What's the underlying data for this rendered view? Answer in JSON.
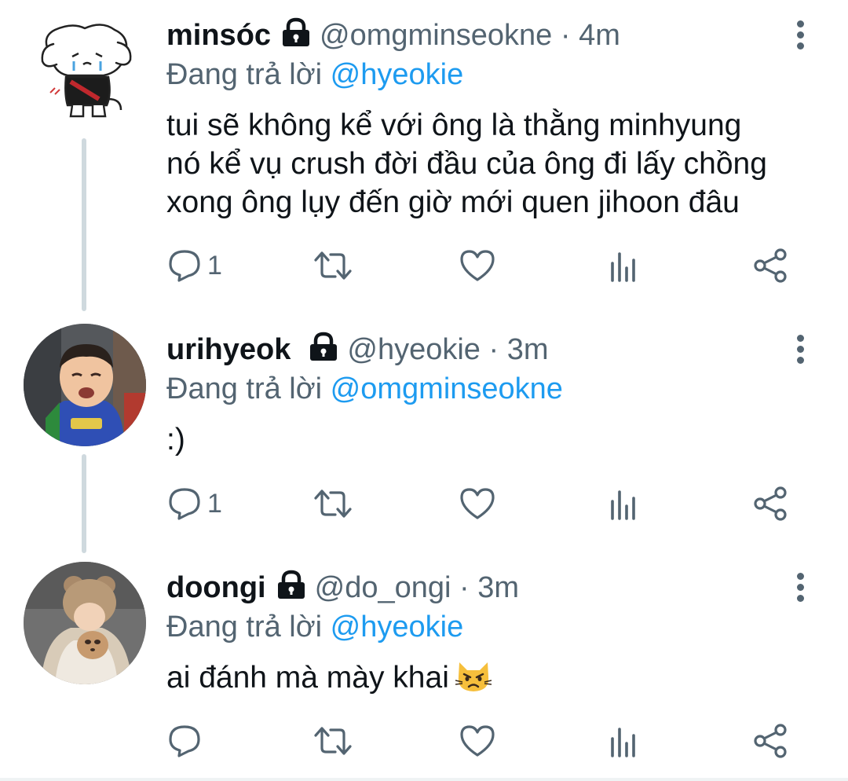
{
  "tweets": [
    {
      "display_name": "minsóc",
      "handle": "@omgminseokne",
      "dot": "·",
      "time": "4m",
      "replying_prefix": "Đang trả lời",
      "replying_to": "@hyeokie",
      "text_lines": [
        "tui sẽ không kể với ông là thằng minhyung",
        "nó kể vụ crush đời đầu của ông đi lấy chồng",
        "xong ông lụy đến giờ mới quen jihoon đâu"
      ],
      "reply_count": "1",
      "avatar": "doodle-puppy-avatar"
    },
    {
      "display_name": "urihyeok",
      "handle": "@hyeokie",
      "dot": "·",
      "time": "3m",
      "replying_prefix": "Đang trả lời",
      "replying_to": "@omgminseokne",
      "text_lines": [
        ":)"
      ],
      "reply_count": "1",
      "avatar": "crying-baby-photo-avatar"
    },
    {
      "display_name": "doongi",
      "handle": "@do_ongi",
      "dot": "·",
      "time": "3m",
      "replying_prefix": "Đang trả lời",
      "replying_to": "@hyeokie",
      "text_lines": [
        "ai đánh mà mày khai"
      ],
      "reply_count": "",
      "avatar": "bear-hat-photo-avatar"
    }
  ],
  "icons": {
    "lock": "lock-icon",
    "more": "more-vertical-icon",
    "reply": "reply-icon",
    "retweet": "retweet-icon",
    "like": "heart-icon",
    "analytics": "analytics-icon",
    "share": "share-icon",
    "emoji": "pouting-cat-emoji"
  },
  "colors": {
    "text": "#0f1419",
    "secondary": "#536471",
    "mention": "#1d9bf0",
    "thread_line": "#cfd9de"
  }
}
